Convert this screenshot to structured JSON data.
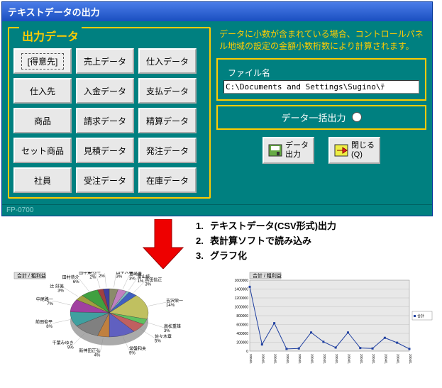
{
  "window": {
    "title": "テキストデータの出力",
    "status": "FP-0700"
  },
  "panel": {
    "legend": "出力データ",
    "buttons": [
      {
        "label": "[得意先]",
        "selected": true
      },
      {
        "label": "売上データ"
      },
      {
        "label": "仕入データ"
      },
      {
        "label": "仕入先"
      },
      {
        "label": "入金データ"
      },
      {
        "label": "支払データ"
      },
      {
        "label": "商品"
      },
      {
        "label": "請求データ"
      },
      {
        "label": "精算データ"
      },
      {
        "label": "セット商品"
      },
      {
        "label": "見積データ"
      },
      {
        "label": "発注データ"
      },
      {
        "label": "社員"
      },
      {
        "label": "受注データ"
      },
      {
        "label": "在庫データ"
      }
    ]
  },
  "info": "データに小数が含まれている場合、コントロールパネル地域の設定の金額小数桁数により計算されます。",
  "file": {
    "label": "ファイル名",
    "value": "C:\\Documents and Settings\\Sugino\\ﾃ"
  },
  "batch": {
    "label": "データ一括出力"
  },
  "actions": {
    "output": "データ\n出力",
    "close": "閉じる\n(Q)"
  },
  "steps": [
    {
      "num": "1.",
      "text": "テキストデータ(CSV形式)出力"
    },
    {
      "num": "2.",
      "text": "表計算ソフトで読み込み"
    },
    {
      "num": "3.",
      "text": "グラフ化"
    }
  ],
  "chart_data": [
    {
      "type": "pie",
      "title": "合計 / 粗利益",
      "series": [
        {
          "name": "田中大輔",
          "value": 3
        },
        {
          "name": "島崎豊",
          "value": 3
        },
        {
          "name": "富山純",
          "value": 1
        },
        {
          "name": "真田信正",
          "value": 3
        },
        {
          "name": "吉沢栄一",
          "value": 14
        },
        {
          "name": "高松重雄",
          "value": 3
        },
        {
          "name": "佐々木章",
          "value": 5
        },
        {
          "name": "常盤和夫",
          "value": 9
        },
        {
          "name": "新神田正弘",
          "value": 4
        },
        {
          "name": "千葉みゆき",
          "value": 9
        },
        {
          "name": "前田俊平",
          "value": 8
        },
        {
          "name": "中尾路一",
          "value": 7
        },
        {
          "name": "辻 好美",
          "value": 3
        },
        {
          "name": "田村恭介",
          "value": 6
        },
        {
          "name": "田中栄二",
          "value": 2
        },
        {
          "name": "田村伸一",
          "value": 2
        }
      ]
    },
    {
      "type": "line",
      "title": "合計 / 粗利益",
      "ylim": [
        0,
        1600000
      ],
      "yticks": [
        0,
        200000,
        400000,
        600000,
        800000,
        1000000,
        1200000,
        1400000,
        1600000
      ],
      "x": [
        "2004/1/5",
        "2004/1/7",
        "2004/1/9",
        "2004/1/11",
        "2004/1/13",
        "2004/1/15",
        "2004/1/17",
        "2004/1/19",
        "2004/1/21",
        "2004/1/23",
        "2004/1/25",
        "2004/1/27",
        "2004/1/29",
        "2004/1/30"
      ],
      "series": [
        {
          "name": "合計",
          "values": [
            1450000,
            150000,
            630000,
            50000,
            60000,
            420000,
            210000,
            80000,
            420000,
            70000,
            60000,
            300000,
            190000,
            50000
          ]
        }
      ]
    }
  ]
}
